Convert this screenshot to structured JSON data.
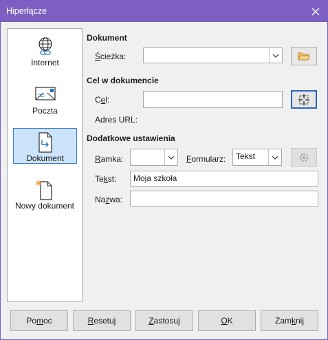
{
  "window": {
    "title": "Hiperłącze"
  },
  "sidebar": {
    "items": [
      {
        "label": "Internet",
        "icon": "globe-link-icon"
      },
      {
        "label": "Poczta",
        "icon": "envelope-icon"
      },
      {
        "label": "Dokument",
        "icon": "document-icon",
        "selected": true
      },
      {
        "label": "Nowy dokument",
        "icon": "new-document-icon"
      }
    ]
  },
  "document_section": {
    "heading": "Dokument",
    "path_label_pre": "Ś",
    "path_label_post": "cieżka:",
    "path_value": ""
  },
  "target_section": {
    "heading": "Cel w dokumencie",
    "target_label_pre": "C",
    "target_label_u": "e",
    "target_label_post": "l:",
    "target_value": "",
    "url_label": "Adres URL:"
  },
  "extra_section": {
    "heading": "Dodatkowe ustawienia",
    "frame_label_u": "R",
    "frame_label_post": "amka:",
    "frame_value": "",
    "form_label_u": "F",
    "form_label_post": "ormularz:",
    "form_value": "Tekst",
    "text_label_pre": "Te",
    "text_label_u": "k",
    "text_label_post": "st:",
    "text_value": "Moja szkoła",
    "name_label_pre": "Na",
    "name_label_u": "z",
    "name_label_post": "wa:",
    "name_value": ""
  },
  "buttons": {
    "help": {
      "pre": "Po",
      "u": "m",
      "post": "oc"
    },
    "reset": {
      "pre": "",
      "u": "R",
      "post": "esetuj"
    },
    "apply": {
      "pre": "",
      "u": "Z",
      "post": "astosuj"
    },
    "ok": {
      "pre": "",
      "u": "O",
      "post": "K"
    },
    "close": {
      "pre": "Zam",
      "u": "k",
      "post": "nij"
    }
  },
  "colors": {
    "titlebar": "#7d5fc2",
    "selection": "#cce4fb",
    "selection_border": "#3b7ed6"
  }
}
